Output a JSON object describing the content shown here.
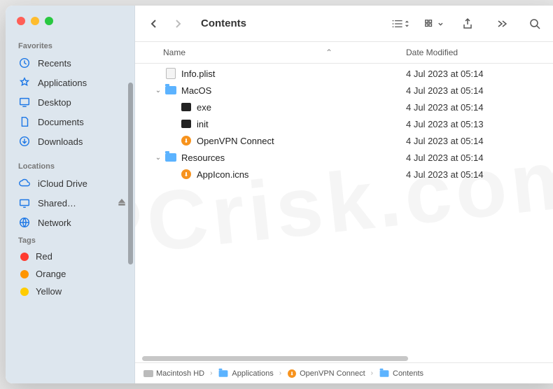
{
  "window": {
    "title": "Contents"
  },
  "sidebar": {
    "sections": {
      "favorites": {
        "title": "Favorites"
      },
      "locations": {
        "title": "Locations"
      },
      "tags": {
        "title": "Tags"
      }
    },
    "favorites": [
      {
        "label": "Recents",
        "icon": "clock"
      },
      {
        "label": "Applications",
        "icon": "apps"
      },
      {
        "label": "Desktop",
        "icon": "desktop"
      },
      {
        "label": "Documents",
        "icon": "documents"
      },
      {
        "label": "Downloads",
        "icon": "downloads"
      }
    ],
    "locations": [
      {
        "label": "iCloud Drive",
        "icon": "cloud"
      },
      {
        "label": "Shared…",
        "icon": "display",
        "eject": true
      },
      {
        "label": "Network",
        "icon": "globe"
      }
    ],
    "tags": [
      {
        "label": "Red",
        "color": "#ff3b30"
      },
      {
        "label": "Orange",
        "color": "#ff9500"
      },
      {
        "label": "Yellow",
        "color": "#ffcc00"
      }
    ]
  },
  "columns": {
    "name": "Name",
    "date": "Date Modified"
  },
  "files": [
    {
      "indent": 0,
      "disclosure": "",
      "icon": "plist",
      "name": "Info.plist",
      "date": "4 Jul 2023 at 05:14"
    },
    {
      "indent": 0,
      "disclosure": "open",
      "icon": "folder",
      "name": "MacOS",
      "date": "4 Jul 2023 at 05:14"
    },
    {
      "indent": 1,
      "disclosure": "",
      "icon": "exec",
      "name": "exe",
      "date": "4 Jul 2023 at 05:14"
    },
    {
      "indent": 1,
      "disclosure": "",
      "icon": "exec",
      "name": "init",
      "date": "4 Jul 2023 at 05:13"
    },
    {
      "indent": 1,
      "disclosure": "",
      "icon": "app",
      "name": "OpenVPN Connect",
      "date": "4 Jul 2023 at 05:14"
    },
    {
      "indent": 0,
      "disclosure": "open",
      "icon": "folder",
      "name": "Resources",
      "date": "4 Jul 2023 at 05:14"
    },
    {
      "indent": 1,
      "disclosure": "",
      "icon": "app",
      "name": "AppIcon.icns",
      "date": "4 Jul 2023 at 05:14"
    }
  ],
  "pathbar": [
    {
      "icon": "drive",
      "label": "Macintosh HD"
    },
    {
      "icon": "folder",
      "label": "Applications"
    },
    {
      "icon": "app",
      "label": "OpenVPN Connect"
    },
    {
      "icon": "folder",
      "label": "Contents"
    }
  ]
}
